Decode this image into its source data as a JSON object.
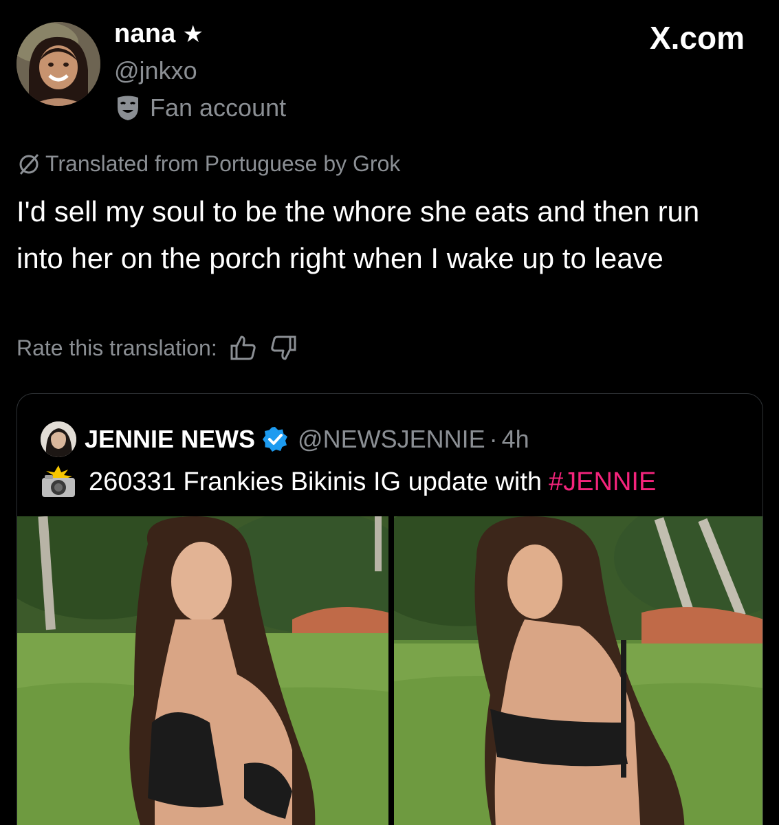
{
  "header": {
    "display_name": "nana",
    "handle": "@jnkxo",
    "fan_label": "Fan account",
    "site_label": "X.com"
  },
  "translation": {
    "label": "Translated from Portuguese by Grok",
    "text": "I'd sell my soul to be the whore she eats and then run into her on the porch right when I wake up to leave",
    "rate_label": "Rate this translation:"
  },
  "quote": {
    "name": "JENNIE NEWS",
    "handle": "@NEWSJENNIE",
    "dot": "·",
    "time": "4h",
    "text": "260331 Frankies Bikinis IG update with",
    "hashtag": "#JENNIE"
  },
  "icons": {
    "star": "star-icon",
    "fan": "theater-mask-icon",
    "grok": "grok-icon",
    "thumbs_up": "thumbs-up-icon",
    "thumbs_down": "thumbs-down-icon",
    "verified": "verified-badge-icon",
    "camera": "camera-flash-icon"
  },
  "colors": {
    "background": "#000000",
    "secondary_text": "#8b8f94",
    "hashtag": "#f4247c",
    "verified": "#1d9bf0",
    "card_border": "#2f3336"
  }
}
